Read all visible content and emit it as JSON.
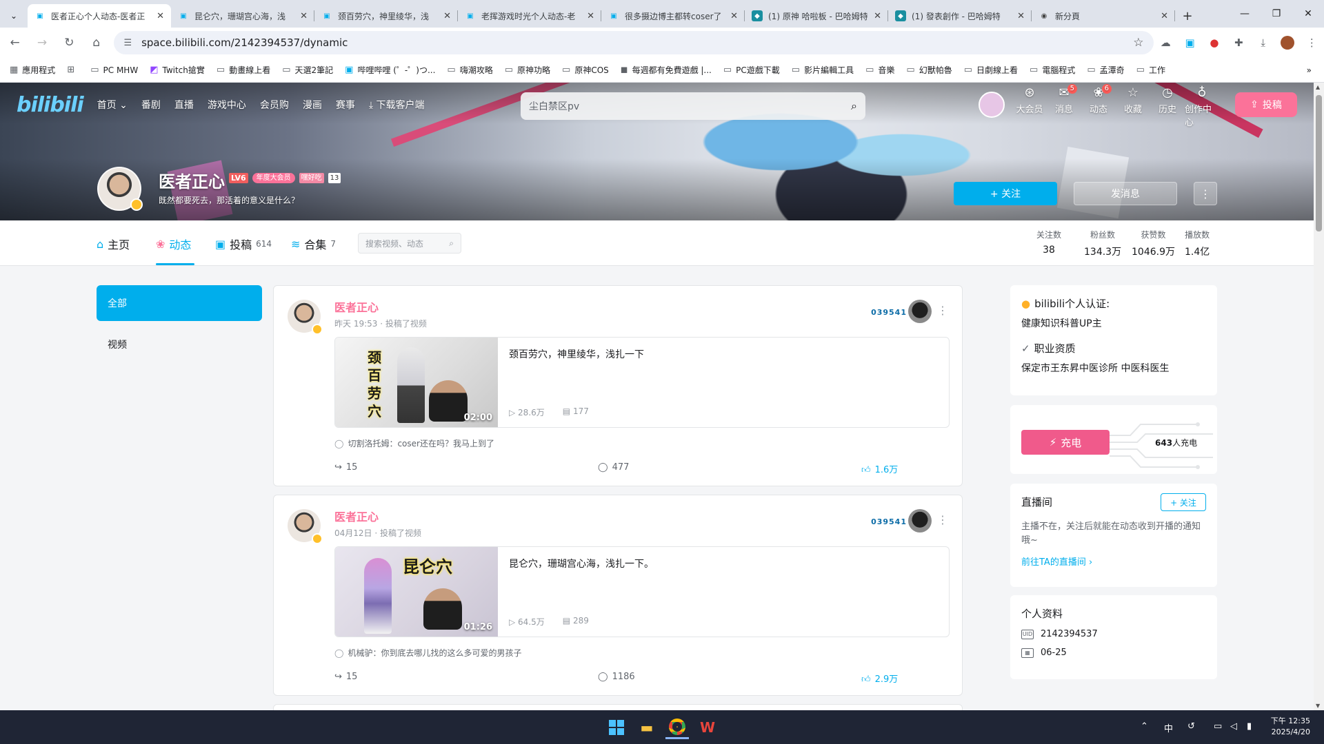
{
  "browser": {
    "tabs": [
      {
        "label": "医者正心个人动态-医者正",
        "active": true
      },
      {
        "label": "昆仑穴，珊瑚宫心海，浅",
        "active": false
      },
      {
        "label": "颈百劳穴，神里绫华，浅",
        "active": false
      },
      {
        "label": "老挥游戏时光个人动态-老",
        "active": false
      },
      {
        "label": "很多摄边博主都转coser了",
        "active": false
      },
      {
        "label": "(1) 原神 哈啦板 - 巴哈姆特",
        "active": false
      },
      {
        "label": "(1) 發表創作 - 巴哈姆特",
        "active": false
      },
      {
        "label": "新分頁",
        "active": false
      }
    ],
    "url": "space.bilibili.com/2142394537/dynamic",
    "bookmarks": [
      "應用程式",
      "PC MHW",
      "Twitch搶實",
      "動畫線上看",
      "天選2筆記",
      "哔哩哔哩 (゜-゜)つ...",
      "嗨潮攻略",
      "原神功略",
      "原神COS",
      "每週都有免費遊戲 |...",
      "PC遊戲下載",
      "影片編輯工具",
      "音樂",
      "幻獸帕魯",
      "日劇線上看",
      "電腦程式",
      "孟潭奇",
      "工作"
    ]
  },
  "site": {
    "logo": "bilibili",
    "nav": [
      "首页",
      "番剧",
      "直播",
      "游戏中心",
      "会员购",
      "漫画",
      "赛事",
      "下载客户端"
    ],
    "search_placeholder": "尘白禁区pv",
    "right_nav": [
      {
        "label": "大会员",
        "icon": "vip-icon",
        "badge": ""
      },
      {
        "label": "消息",
        "icon": "message-icon",
        "badge": "5"
      },
      {
        "label": "动态",
        "icon": "dynamic-icon",
        "badge": "6"
      },
      {
        "label": "收藏",
        "icon": "star-icon",
        "badge": ""
      },
      {
        "label": "历史",
        "icon": "history-icon",
        "badge": ""
      },
      {
        "label": "创作中心",
        "icon": "bulb-icon",
        "badge": ""
      }
    ],
    "upload_label": "投稿"
  },
  "profile": {
    "name": "医者正心",
    "level": "LV6",
    "vip": "年度大会员",
    "medal": "嘿好吃",
    "medal_level": "13",
    "sign": "既然都要死去，那活着的意义是什么？",
    "follow_label": "+ 关注",
    "message_label": "发消息",
    "tabs": [
      {
        "label": "主页",
        "count": ""
      },
      {
        "label": "动态",
        "count": ""
      },
      {
        "label": "投稿",
        "count": "614"
      },
      {
        "label": "合集",
        "count": "7"
      }
    ],
    "search_placeholder": "搜索视频、动态",
    "stats": [
      {
        "label": "关注数",
        "value": "38"
      },
      {
        "label": "粉丝数",
        "value": "134.3万"
      },
      {
        "label": "获赞数",
        "value": "1046.9万"
      },
      {
        "label": "播放数",
        "value": "1.4亿"
      }
    ]
  },
  "filter": [
    "全部",
    "视频"
  ],
  "feed": [
    {
      "author": "医者正心",
      "time": "昨天 19:53 · 投稿了视频",
      "fan_badge": "039541",
      "video_title": "颈百劳穴，神里绫华，浅扎一下",
      "thumb_caption": "颈百劳穴",
      "duration": "02:00",
      "views": "28.6万",
      "danmaku": "177",
      "hot_comment": "切割洛托姆：coser还在吗？我马上到了",
      "shares": "15",
      "comments": "477",
      "likes": "1.6万"
    },
    {
      "author": "医者正心",
      "time": "04月12日 · 投稿了视频",
      "fan_badge": "039541",
      "video_title": "昆仑穴，珊瑚宫心海，浅扎一下。",
      "thumb_caption": "昆仑穴",
      "duration": "01:26",
      "views": "64.5万",
      "danmaku": "289",
      "hot_comment": "机械驴：你到底去哪儿找的这么多可爱的男孩子",
      "shares": "15",
      "comments": "1186",
      "likes": "2.9万"
    }
  ],
  "sidebar": {
    "cert_title": "bilibili个人认证:",
    "cert_text": "健康知识科普UP主",
    "qual_title": "职业资质",
    "qual_text": "保定市王东昇中医诊所 中医科医生",
    "charge_label": "充电",
    "charge_count": "643",
    "charge_suffix": "人充电",
    "live_title": "直播间",
    "live_follow": "+ 关注",
    "live_text": "主播不在，关注后就能在动态收到开播的通知哦~",
    "live_link": "前往TA的直播间 ›",
    "info_title": "个人资料",
    "uid": "2142394537",
    "birthday": "06-25"
  },
  "taskbar": {
    "ime": "中",
    "time": "下午 12:35",
    "date": "2025/4/20"
  },
  "colors": {
    "accent": "#00aeec",
    "pink": "#fb7299"
  }
}
